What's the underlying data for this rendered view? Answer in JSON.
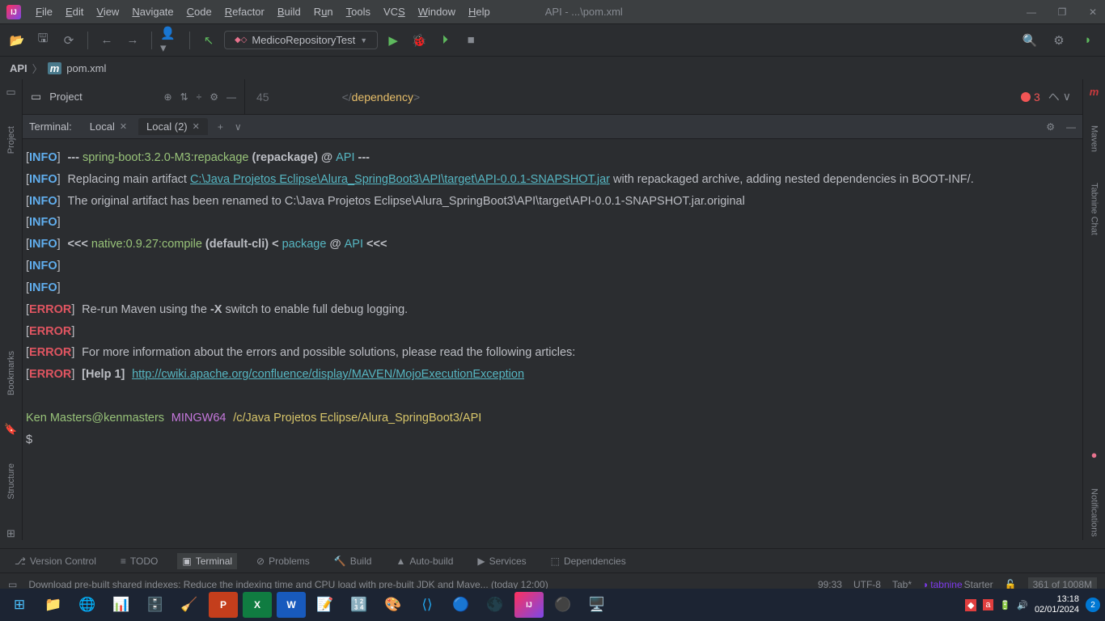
{
  "menus": [
    "File",
    "Edit",
    "View",
    "Navigate",
    "Code",
    "Refactor",
    "Build",
    "Run",
    "Tools",
    "VCS",
    "Window",
    "Help"
  ],
  "title": "API - ...\\pom.xml",
  "runConfig": "MedicoRepositoryTest",
  "breadcrumb": {
    "root": "API",
    "file": "pom.xml"
  },
  "projectTool": "Project",
  "editor": {
    "lineNum": "45",
    "tagText": "dependency"
  },
  "errorCount": "3",
  "terminal": {
    "label": "Terminal:",
    "tab1": "Local",
    "tab2": "Local (2)",
    "lines": {
      "l1a": "--- ",
      "l1b": "spring-boot:3.2.0-M3:repackage",
      "l1c": " (repackage) @ ",
      "l1d": "API",
      "l1e": " ---",
      "l2a": "Replacing main artifact ",
      "l2link": "C:\\Java Projetos Eclipse\\Alura_SpringBoot3\\API\\target\\API-0.0.1-SNAPSHOT.jar",
      "l2b": " with repackaged archive, adding nested dependencies in BOOT-INF/.",
      "l3": "The original artifact has been renamed to C:\\Java Projetos Eclipse\\Alura_SpringBoot3\\API\\target\\API-0.0.1-SNAPSHOT.jar.original",
      "l5a": "<<< ",
      "l5b": "native:0.9.27:compile",
      "l5c": " (default-cli) < ",
      "l5d": "package",
      "l5e": " @ ",
      "l5f": "API",
      "l5g": " <<<",
      "l8": "Re-run Maven using the ",
      "l8b": "-X",
      "l8c": " switch to enable full debug logging.",
      "l10": "For more information about the errors and possible solutions, please read the following articles:",
      "l11a": "[Help 1]",
      "l11link": "http://cwiki.apache.org/confluence/display/MAVEN/MojoExecutionException",
      "promptUser": "Ken Masters@kenmasters",
      "promptHost": "MINGW64",
      "promptPath": "/c/Java Projetos Eclipse/Alura_SpringBoot3/API",
      "cursor": "$"
    }
  },
  "leftTools": [
    "Project",
    "Bookmarks",
    "Structure"
  ],
  "rightTools": [
    "Maven",
    "Tabnine Chat",
    "Notifications"
  ],
  "bottomTools": [
    "Version Control",
    "TODO",
    "Terminal",
    "Problems",
    "Build",
    "Auto-build",
    "Services",
    "Dependencies"
  ],
  "status": {
    "msg": "Download pre-built shared indexes: Reduce the indexing time and CPU load with pre-built JDK and Mave... (today 12:00)",
    "pos": "99:33",
    "enc": "UTF-8",
    "tab": "Tab*",
    "tabnine": "tabnine",
    "tabnineTier": "Starter",
    "mem": "361 of 1008M"
  },
  "clock": {
    "time": "13:18",
    "date": "02/01/2024"
  },
  "notifCount": "2"
}
